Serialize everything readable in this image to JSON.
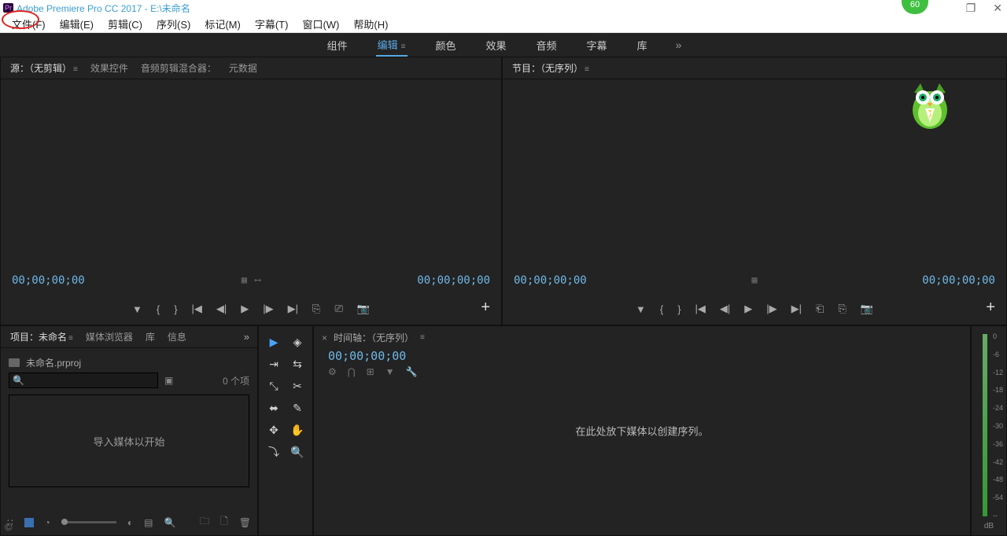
{
  "title": "Adobe Premiere Pro CC 2017 - E:\\未命名",
  "badge": "60",
  "menu": [
    "文件(F)",
    "编辑(E)",
    "剪辑(C)",
    "序列(S)",
    "标记(M)",
    "字幕(T)",
    "窗口(W)",
    "帮助(H)"
  ],
  "workspace": {
    "items": [
      "组件",
      "编辑",
      "颜色",
      "效果",
      "音频",
      "字幕",
      "库"
    ],
    "active": 1
  },
  "source": {
    "tabs": [
      "源：（无剪辑）",
      "效果控件",
      "音频剪辑混合器：",
      "元数据"
    ],
    "tc_left": "00;00;00;00",
    "tc_right": "00;00;00;00"
  },
  "program": {
    "title": "节目：（无序列）",
    "tc_left": "00;00;00;00",
    "tc_right": "00;00;00;00"
  },
  "project": {
    "tabs": [
      "项目：未命名",
      "媒体浏览器",
      "库",
      "信息"
    ],
    "filename": "未命名.prproj",
    "count": "0 个项",
    "drop": "导入媒体以开始"
  },
  "timeline": {
    "label": "时间轴：（无序列）",
    "tc": "00;00;00;00",
    "drop": "在此处放下媒体以创建序列。"
  },
  "meter": {
    "labels": [
      "0",
      "-6",
      "-12",
      "-18",
      "-24",
      "-30",
      "-36",
      "-42",
      "-48",
      "-54",
      "--"
    ],
    "unit": "dB"
  }
}
